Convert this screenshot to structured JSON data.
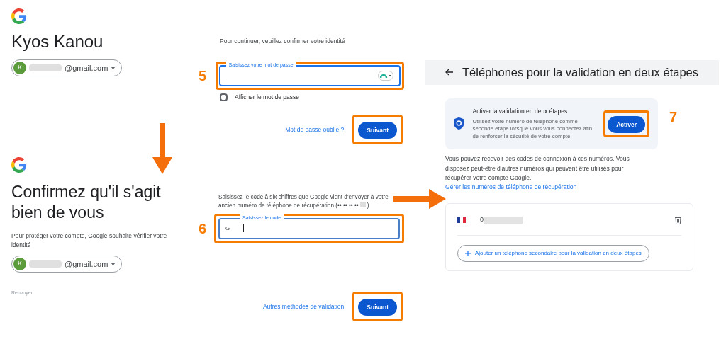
{
  "password_screen": {
    "step": "5",
    "name": "Kyos Kanou",
    "account": {
      "initial": "K",
      "email": "@gmail.com"
    },
    "prompt": "Pour continuer, veuillez confirmer votre identité",
    "field": {
      "label": "Saisissez votre mot de passe"
    },
    "show_password": {
      "label": "Afficher le mot de passe",
      "checked": false
    },
    "forgot_link": "Mot de passe oublié ?",
    "next_button": "Suivant"
  },
  "code_screen": {
    "step": "6",
    "title": "Confirmez qu'il s'agit bien de vous",
    "subtitle": "Pour protéger votre compte, Google souhaite vérifier votre identité",
    "account": {
      "initial": "K",
      "email": "@gmail.com"
    },
    "resend": "Renvoyer",
    "instruction": "Saisissez le code à six chiffres que Google vient d'envoyer à votre ancien numéro de téléphone de récupération (•• •• •• ••",
    "instruction_end": ")",
    "field": {
      "label": "Saisissez le code",
      "prefix": "G-"
    },
    "other_methods": "Autres méthodes de validation",
    "next_button": "Suivant"
  },
  "phones_screen": {
    "step": "7",
    "title": "Téléphones pour la validation en deux étapes",
    "banner": {
      "title": "Activer la validation en deux étapes",
      "text": "Utilisez votre numéro de téléphone comme seconde étape lorsque vous vous connectez afin de renforcer la sécurité de votre compte",
      "button": "Activer"
    },
    "info": "Vous pouvez recevoir des codes de connexion à ces numéros. Vous disposez peut-être d'autres numéros qui peuvent être utilisés pour récupérer votre compte Google.",
    "info_link": "Gérer les numéros de téléphone de récupération",
    "phones": [
      {
        "number": "0"
      }
    ],
    "add_button": "Ajouter un téléphone secondaire pour la validation en deux étapes"
  }
}
